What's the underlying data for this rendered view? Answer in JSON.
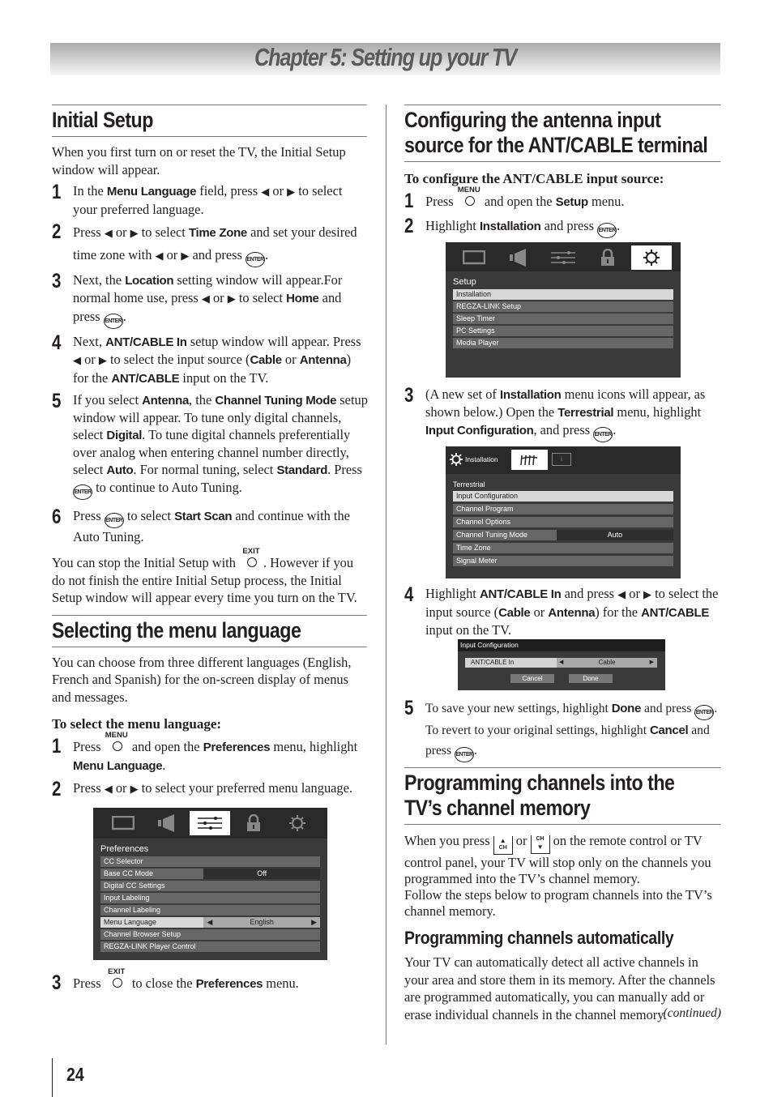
{
  "chapter_title": "Chapter 5: Setting up your TV",
  "page_number": "24",
  "icons": {
    "enter": "ENTER",
    "menu": "MENU",
    "exit": "EXIT",
    "left": "◀",
    "right": "▶",
    "ch": "CH",
    "up": "▲",
    "down": "▼"
  },
  "initial_setup": {
    "heading": "Initial Setup",
    "intro": "When you first turn on or reset the TV, the Initial Setup window will appear.",
    "steps": [
      {
        "num": "1",
        "a": "In the ",
        "b1": "Menu Language",
        "c": " field, press ",
        "d": " or ",
        "e": " to select  your preferred language."
      },
      {
        "num": "2",
        "a": "Press ",
        "b": " or ",
        "c": " to select ",
        "b1": "Time Zone",
        "d": " and set your desired time zone with ",
        "e": " or ",
        "f": " and press ",
        "g": "."
      },
      {
        "num": "3",
        "a": "Next, the ",
        "b1": "Location",
        "c": " setting window will appear.For normal home use, press ",
        "d": " or ",
        "e": " to select ",
        "b2": "Home",
        "f": " and press ",
        "g": "."
      },
      {
        "num": "4",
        "a": "Next, ",
        "b1": "ANT/CABLE In",
        "c": " setup window will appear. Press ",
        "d": " or ",
        "e": " to select the input source (",
        "b2": "Cable",
        "f": " or ",
        "b3": "Antenna",
        "g": ") for the ",
        "b4": "ANT/CABLE",
        "h": " input on the TV."
      },
      {
        "num": "5",
        "a": "If you select ",
        "b1": "Antenna",
        "c": ", the ",
        "b2": "Channel Tuning Mode",
        "d": " setup window will appear. To tune only digital channels, select ",
        "b3": "Digital",
        "e": ". To tune digital channels preferentially over analog when entering channel number directly, select ",
        "b4": "Auto",
        "f": ". For normal tuning, select ",
        "b5": "Standard",
        "g": ". Press ",
        "h": " to continue to Auto Tuning."
      },
      {
        "num": "6",
        "a": "Press ",
        "b": " to select ",
        "b1": "Start Scan",
        "c": " and continue with the Auto Tuning."
      }
    ],
    "note_a": "You can stop the Initial Setup with ",
    "note_b": ". However if you do not finish the entire Initial Setup process, the Initial Setup window will appear every time you turn on the TV."
  },
  "menu_language": {
    "heading": "Selecting the menu language",
    "intro": "You can choose from three different languages (English, French and Spanish) for the on-screen display of menus and messages.",
    "subheading": "To select the menu language:",
    "steps": [
      {
        "num": "1",
        "a": "Press ",
        "b": " and open the ",
        "b1": "Preferences",
        "c": " menu, highlight ",
        "b2": "Menu Language",
        "d": "."
      },
      {
        "num": "2",
        "a": "Press ",
        "b": " or ",
        "c": " to select your preferred menu language."
      },
      {
        "num": "3",
        "a": "Press ",
        "b": " to close the ",
        "b1": "Preferences",
        "c": " menu."
      }
    ],
    "screen": {
      "title": "Preferences",
      "rows": [
        {
          "label": "CC Selector"
        },
        {
          "label": "Base CC Mode",
          "value": "Off"
        },
        {
          "label": "Digital CC Settings"
        },
        {
          "label": "Input Labeling"
        },
        {
          "label": "Channel Labeling"
        },
        {
          "label": "Menu Language",
          "value": "English"
        },
        {
          "label": "Channel Browser Setup"
        },
        {
          "label": "REGZA-LINK Player Control"
        }
      ]
    }
  },
  "antenna": {
    "heading_l1": "Configuring the antenna input",
    "heading_l2": "source for the ANT/CABLE terminal",
    "subheading": "To configure the ANT/CABLE input source:",
    "steps": [
      {
        "num": "1",
        "a": "Press ",
        "b": " and open the ",
        "b1": "Setup",
        "c": " menu."
      },
      {
        "num": "2",
        "a": "Highlight ",
        "b1": "Installation",
        "c": " and press ",
        "d": "."
      },
      {
        "num": "3",
        "a": "(A new set of ",
        "b1": "Installation",
        "c": " menu icons will appear, as shown below.) Open the ",
        "b2": "Terrestrial",
        "d": " menu, highlight ",
        "b3": "Input Configuration",
        "e": ", and press ",
        "f": "."
      },
      {
        "num": "4",
        "a": "Highlight ",
        "b1": "ANT/CABLE In",
        "c": " and press ",
        "d": " or ",
        "e": " to select the input source (",
        "b2": "Cable",
        "f": " or ",
        "b3": "Antenna",
        "g": ") for the ",
        "b4": "ANT/CABLE",
        "h": " input on the TV."
      },
      {
        "num": "5",
        "a": "To save your new settings, highlight ",
        "b1": "Done",
        "c": " and press ",
        "d": ". To revert to your original settings, highlight ",
        "b2": "Cancel",
        "e": " and press ",
        "f": "."
      }
    ],
    "setup_screen": {
      "title": "Setup",
      "rows": [
        "Installation",
        "REGZA-LINK Setup",
        "Sleep Timer",
        "PC Settings",
        "Media Player"
      ]
    },
    "install_screen": {
      "header": "Installation",
      "info_tab": "i",
      "title": "Terrestrial",
      "rows": [
        {
          "label": "Input Configuration"
        },
        {
          "label": "Channel Program"
        },
        {
          "label": "Channel Options"
        },
        {
          "label": "Channel Tuning Mode",
          "value": "Auto"
        },
        {
          "label": "Time Zone"
        },
        {
          "label": "Signal Meter"
        }
      ]
    },
    "input_dialog": {
      "title": "Input Configuration",
      "field_label": "ANT/CABLE In",
      "field_value": "Cable",
      "cancel": "Cancel",
      "done": "Done"
    }
  },
  "programming": {
    "heading_l1": "Programming channels into the",
    "heading_l2": "TV’s channel memory",
    "p1_a": "When you press ",
    "p1_b": " or ",
    "p1_c": " on the remote control or TV control panel, your TV will stop only on the channels you programmed into the TV’s channel memory.",
    "p2": "Follow the steps below to program channels into the TV’s channel memory.",
    "subheading": "Programming channels automatically",
    "p3": "Your TV can automatically detect all active channels in your area and store them in its memory. After the channels are programmed automatically, you can manually add or erase individual channels in the channel memory.",
    "continued": "(continued)"
  }
}
